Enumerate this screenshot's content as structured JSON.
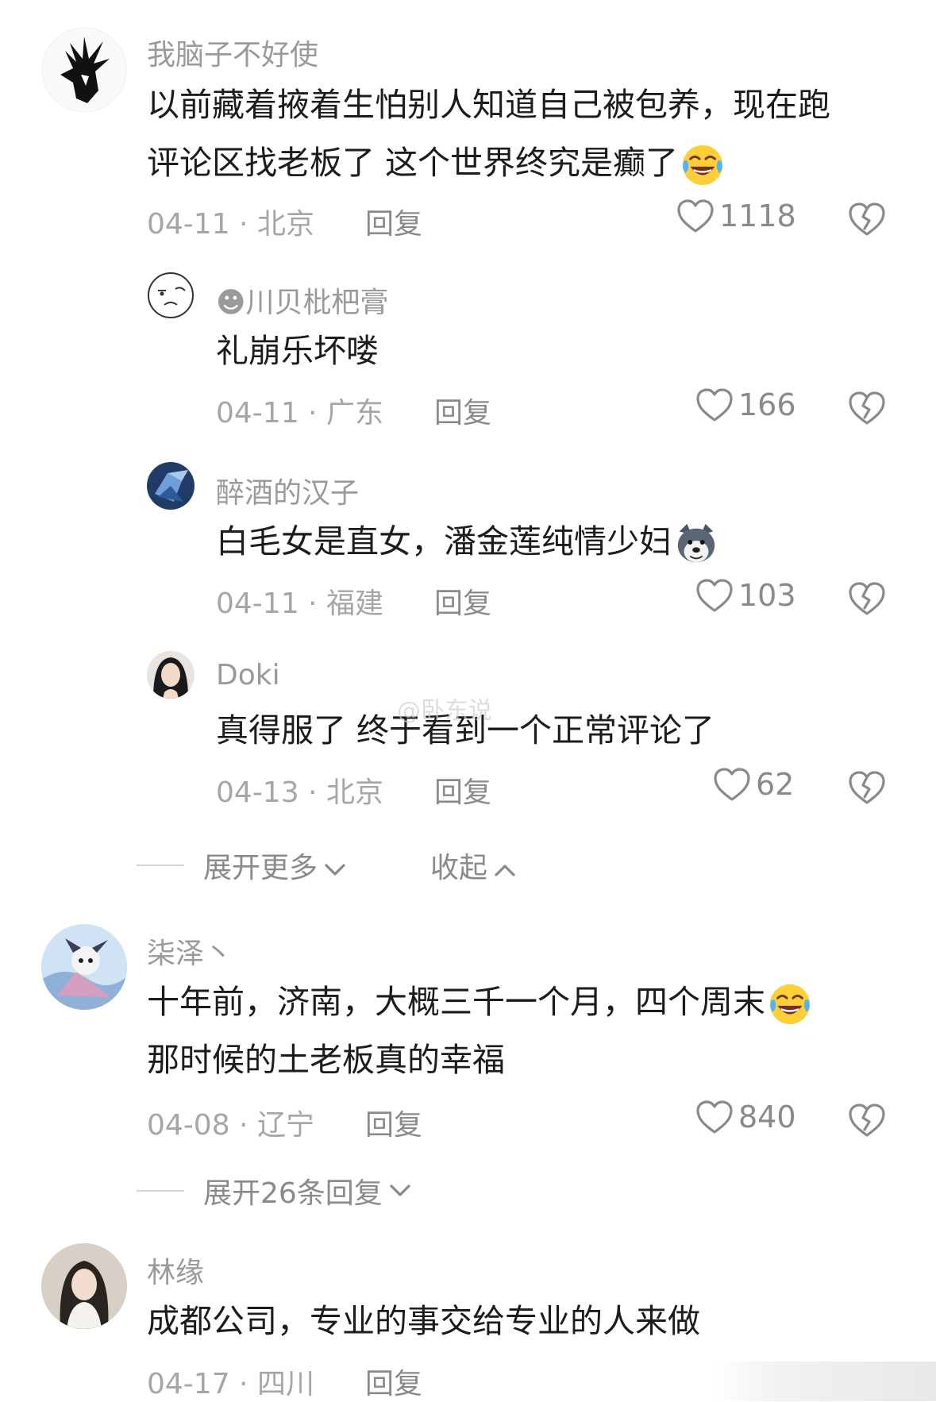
{
  "comments": [
    {
      "name": "我脑子不好使",
      "lines": [
        "以前藏着掖着生怕别人知道自己被包养，现在跑",
        "评论区找老板了  这个世界终究是癫了"
      ],
      "date": "04-11",
      "location": "北京",
      "reply_label": "回复",
      "likes": "1118",
      "emoji": "laugh-cry"
    },
    {
      "name": "☻川贝枇杷膏",
      "lines": [
        "礼崩乐坏喽"
      ],
      "date": "04-11",
      "location": "广东",
      "reply_label": "回复",
      "likes": "166"
    },
    {
      "name": "醉酒的汉子",
      "lines": [
        "白毛女是直女，潘金莲纯情少妇"
      ],
      "date": "04-11",
      "location": "福建",
      "reply_label": "回复",
      "likes": "103",
      "emoji": "husky"
    },
    {
      "name": "Doki",
      "lines": [
        "真得服了  终于看到一个正常评论了"
      ],
      "date": "04-13",
      "location": "北京",
      "reply_label": "回复",
      "likes": "62"
    },
    {
      "name": "柒泽丶",
      "lines": [
        "十年前，济南，大概三千一个月，四个周末",
        "那时候的土老板真的幸福"
      ],
      "date": "04-08",
      "location": "辽宁",
      "reply_label": "回复",
      "likes": "840",
      "emoji": "laugh-cry"
    },
    {
      "name": "林缘",
      "lines": [
        "成都公司，专业的事交给专业的人来做"
      ],
      "date": "04-17",
      "location": "四川",
      "reply_label": "回复"
    }
  ],
  "thread_controls": {
    "expand_more": "展开更多",
    "collapse": "收起"
  },
  "expand_replies": "展开26条回复",
  "watermark": "@卧东说",
  "colors": {
    "text": "#1c1c1c",
    "muted": "#9a9a9a",
    "divider": "#d6d6d6"
  },
  "icons": [
    "heart-icon",
    "broken-heart-icon",
    "chevron-down-icon",
    "chevron-up-icon",
    "laugh-cry-emoji",
    "husky-emoji"
  ]
}
